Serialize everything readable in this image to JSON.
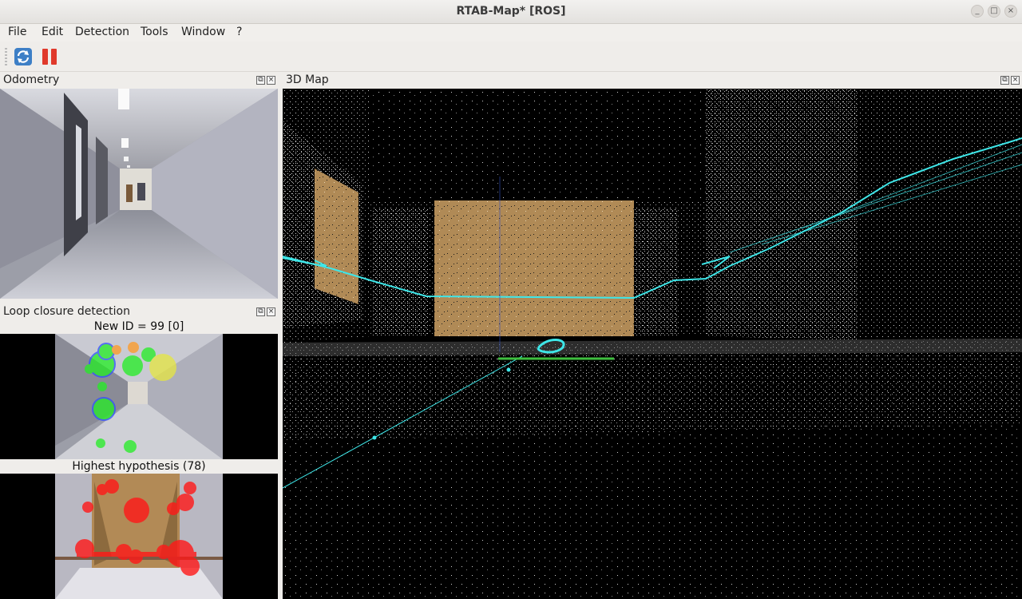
{
  "window": {
    "title": "RTAB-Map* [ROS]",
    "controls": [
      "_",
      "□",
      "×"
    ]
  },
  "menu": [
    "File",
    "Edit",
    "Detection",
    "Tools",
    "Window",
    "?"
  ],
  "toolbar": {
    "refresh_icon": "refresh-icon",
    "pause_icon": "pause-icon"
  },
  "docks": {
    "odometry": {
      "title": "Odometry"
    },
    "loop_closure": {
      "title": "Loop closure detection",
      "new_id_caption": "New ID = 99 [0]",
      "hypothesis_caption": "Highest hypothesis (78)"
    },
    "map3d": {
      "title": "3D Map"
    }
  },
  "dock_controls": {
    "float": "⧉",
    "close": "×"
  },
  "colors": {
    "trajectory": "#3ee6e8",
    "loop_link": "#3fbf3f",
    "new_features": "#22ee22",
    "hypothesis_features": "#ff1818"
  }
}
